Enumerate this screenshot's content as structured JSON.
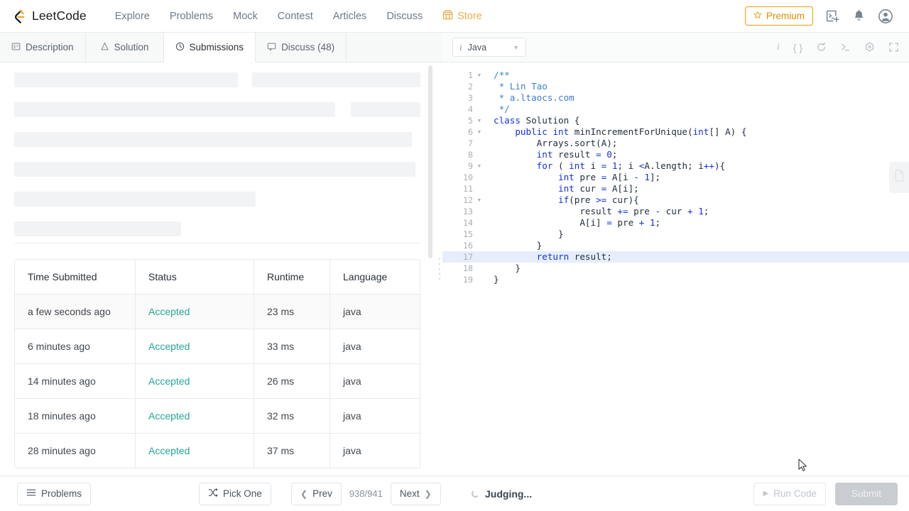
{
  "navbar": {
    "brand": "LeetCode",
    "links": [
      {
        "label": "Explore",
        "icon": ""
      },
      {
        "label": "Problems",
        "icon": ""
      },
      {
        "label": "Mock",
        "icon": ""
      },
      {
        "label": "Contest",
        "icon": ""
      },
      {
        "label": "Articles",
        "icon": ""
      },
      {
        "label": "Discuss",
        "icon": ""
      },
      {
        "label": "Store",
        "icon": "store-icon"
      }
    ],
    "premium_label": "Premium",
    "icons": [
      "star-icon",
      "terminal-plus-icon",
      "bell-icon",
      "user-avatar-icon"
    ],
    "colors": {
      "premium": "#d99100",
      "store": "#f0ad4e",
      "logo_accent": "#f5a623"
    }
  },
  "tabs": [
    {
      "label": "Description",
      "icon": "document-icon",
      "active": false
    },
    {
      "label": "Solution",
      "icon": "flask-icon",
      "active": false
    },
    {
      "label": "Submissions",
      "icon": "clock-icon",
      "active": true
    },
    {
      "label": "Discuss (48)",
      "icon": "comment-icon",
      "active": false
    }
  ],
  "editor_toolbar": {
    "language": "Java",
    "language_icon": "italic-i-icon",
    "tools": [
      {
        "name": "info-icon",
        "glyph": "i"
      },
      {
        "name": "format-braces-icon",
        "glyph": "{}"
      },
      {
        "name": "reset-icon",
        "glyph": "↺"
      },
      {
        "name": "console-icon",
        "glyph": "›_"
      },
      {
        "name": "settings-icon",
        "glyph": "⚙"
      },
      {
        "name": "fullscreen-icon",
        "glyph": "⛶"
      }
    ]
  },
  "skeleton": {
    "rows": [
      [
        320,
        240
      ],
      [
        460,
        100
      ],
      [
        560
      ],
      [
        565
      ],
      [
        340
      ],
      [
        235
      ]
    ]
  },
  "submissions_table": {
    "columns": [
      "Time Submitted",
      "Status",
      "Runtime",
      "Language"
    ],
    "rows": [
      {
        "time": "a few seconds ago",
        "status": "Accepted",
        "runtime": "23 ms",
        "language": "java",
        "shaded": true
      },
      {
        "time": "6 minutes ago",
        "status": "Accepted",
        "runtime": "33 ms",
        "language": "java",
        "shaded": false
      },
      {
        "time": "14 minutes ago",
        "status": "Accepted",
        "runtime": "26 ms",
        "language": "java",
        "shaded": false
      },
      {
        "time": "18 minutes ago",
        "status": "Accepted",
        "runtime": "32 ms",
        "language": "java",
        "shaded": false
      },
      {
        "time": "28 minutes ago",
        "status": "Accepted",
        "runtime": "37 ms",
        "language": "java",
        "shaded": false
      }
    ],
    "status_color": "#26a69a"
  },
  "code": {
    "language": "java",
    "highlighted_line": 17,
    "fold_lines": [
      1,
      5,
      6,
      9,
      12
    ],
    "lines": [
      "/**",
      " * Lin Tao",
      " * a.ltaocs.com",
      " */",
      "class Solution {",
      "    public int minIncrementForUnique(int[] A) {",
      "        Arrays.sort(A);",
      "        int result = 0;",
      "        for ( int i = 1; i <A.length; i++){",
      "            int pre = A[i - 1];",
      "            int cur = A[i];",
      "            if(pre >= cur){",
      "                result += pre - cur + 1;",
      "                A[i] = pre + 1;",
      "            }",
      "        }",
      "        return result;",
      "    }",
      "}"
    ]
  },
  "bottombar": {
    "problems_label": "Problems",
    "pick_one_label": "Pick One",
    "prev_label": "Prev",
    "next_label": "Next",
    "page_counter": "938/941",
    "status_text": "Judging...",
    "run_code_label": "Run Code",
    "submit_label": "Submit"
  },
  "note_tab": {
    "icon": "note-panel-icon"
  }
}
